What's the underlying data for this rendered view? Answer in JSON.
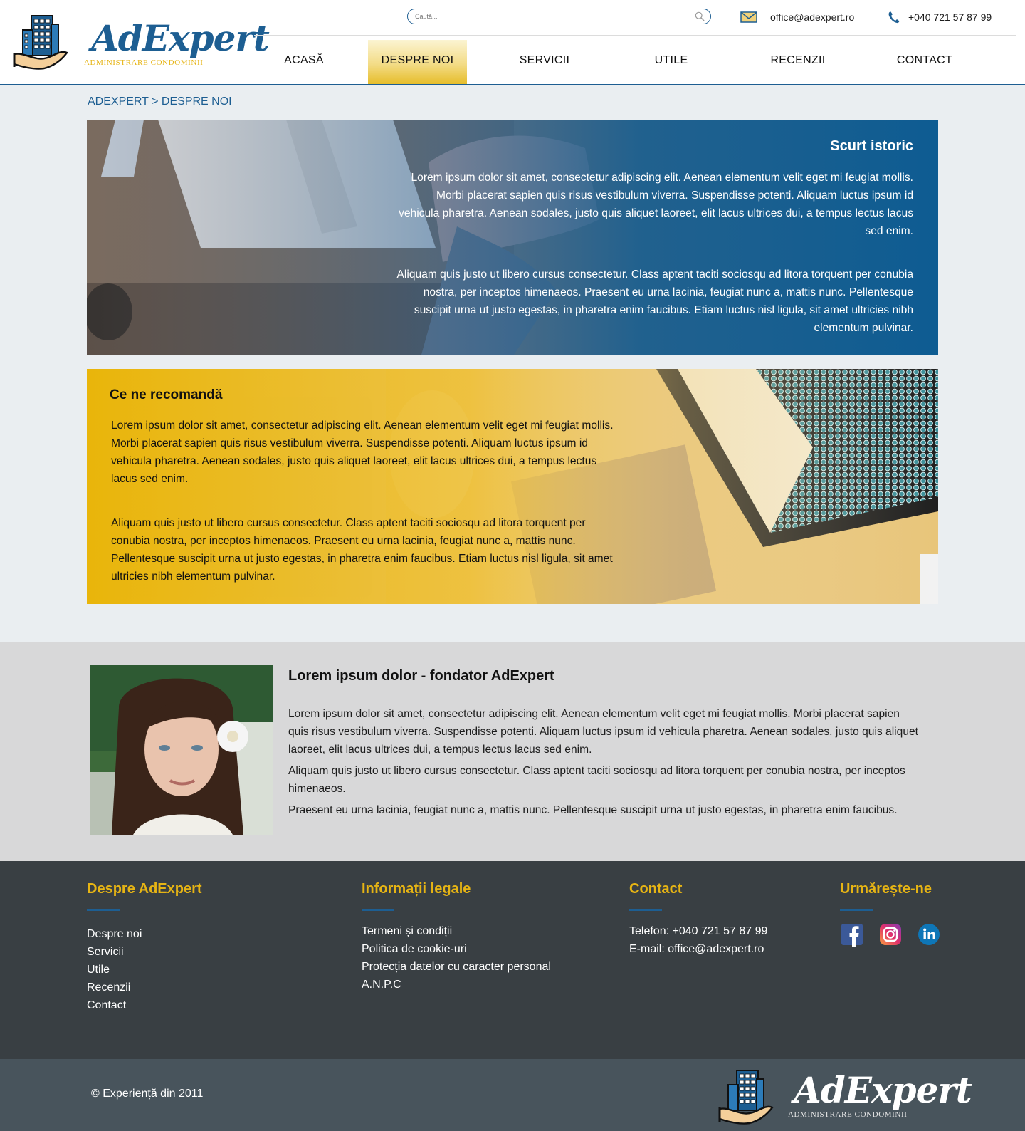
{
  "brand": {
    "name": "AdExpert",
    "tagline": "ADMINISTRARE CONDOMINII",
    "icon": "building-in-hand-logo"
  },
  "header": {
    "search": {
      "placeholder": "Caută...",
      "icon": "search-icon"
    },
    "email": {
      "icon": "envelope-icon",
      "text": "office@adexpert.ro"
    },
    "phone": {
      "icon": "phone-icon",
      "text": "+040 721 57 87 99"
    },
    "nav": [
      {
        "label": "ACASĂ",
        "active": false
      },
      {
        "label": "DESPRE NOI",
        "active": true
      },
      {
        "label": "SERVICII",
        "active": false
      },
      {
        "label": "UTILE",
        "active": false
      },
      {
        "label": "RECENZII",
        "active": false
      },
      {
        "label": "CONTACT",
        "active": false
      }
    ]
  },
  "breadcrumb": "ADEXPERT > DESPRE NOI",
  "history": {
    "title": "Scurt istoric",
    "paragraphs": [
      "Lorem ipsum dolor sit amet, consectetur adipiscing elit. Aenean elementum velit eget mi feugiat mollis. Morbi placerat sapien quis risus vestibulum viverra. Suspendisse potenti. Aliquam luctus ipsum id vehicula pharetra. Aenean sodales, justo quis aliquet laoreet, elit lacus ultrices dui, a tempus lectus lacus sed enim.",
      "Aliquam quis justo ut libero cursus consectetur. Class aptent taciti sociosqu ad litora torquent per conubia nostra, per inceptos himenaeos. Praesent eu urna lacinia, feugiat nunc a, mattis nunc. Pellentesque suscipit urna ut justo egestas, in pharetra enim faucibus. Etiam luctus nisl ligula, sit amet ultricies nibh elementum pulvinar."
    ]
  },
  "recommend": {
    "title": "Ce ne recomandă",
    "paragraphs": [
      "Lorem ipsum dolor sit amet, consectetur adipiscing elit. Aenean elementum velit eget mi feugiat mollis. Morbi placerat sapien quis risus vestibulum viverra. Suspendisse potenti. Aliquam luctus ipsum id vehicula pharetra. Aenean sodales, justo quis aliquet laoreet, elit lacus ultrices dui, a tempus lectus lacus sed enim.",
      "Aliquam quis justo ut libero cursus consectetur. Class aptent taciti sociosqu ad litora torquent per conubia nostra, per inceptos himenaeos. Praesent eu urna lacinia, feugiat nunc a, mattis nunc. Pellentesque suscipit urna ut justo egestas, in pharetra enim faucibus. Etiam luctus nisl ligula, sit amet ultricies nibh elementum pulvinar."
    ]
  },
  "founder": {
    "title": "Lorem ipsum dolor - fondator AdExpert",
    "paragraphs": [
      "Lorem ipsum dolor sit amet, consectetur adipiscing elit. Aenean elementum velit eget mi feugiat mollis. Morbi placerat sapien quis risus vestibulum viverra. Suspendisse potenti. Aliquam luctus ipsum id vehicula pharetra. Aenean sodales, justo quis aliquet laoreet, elit lacus ultrices dui, a tempus lectus lacus sed enim.",
      "Aliquam quis justo ut libero cursus consectetur. Class aptent taciti sociosqu ad litora torquent per conubia nostra, per inceptos himenaeos.",
      "Praesent eu urna lacinia, feugiat nunc a, mattis nunc. Pellentesque suscipit urna ut justo egestas, in pharetra enim faucibus."
    ]
  },
  "footer": {
    "about": {
      "title": "Despre AdExpert",
      "links": [
        "Despre noi",
        "Servicii",
        "Utile",
        "Recenzii",
        "Contact"
      ]
    },
    "legal": {
      "title": "Informații legale",
      "links": [
        "Termeni și condiții",
        "Politica de cookie-uri",
        "Protecția datelor cu caracter personal",
        "A.N.P.C"
      ]
    },
    "contact": {
      "title": "Contact",
      "lines": [
        "Telefon: +040 721 57 87 99",
        "E-mail: office@adexpert.ro"
      ]
    },
    "follow": {
      "title": "Urmărește-ne",
      "icons": [
        "facebook-icon",
        "instagram-icon",
        "linkedin-icon"
      ]
    },
    "copyright": "© Experiență din 2011"
  },
  "colors": {
    "brand_blue": "#1d5e92",
    "brand_yellow": "#e6b414",
    "footer_dark": "#393f43",
    "footer_bottom": "#48545c",
    "founder_bg": "#d8d8d9",
    "page_bg": "#eaeef1"
  }
}
